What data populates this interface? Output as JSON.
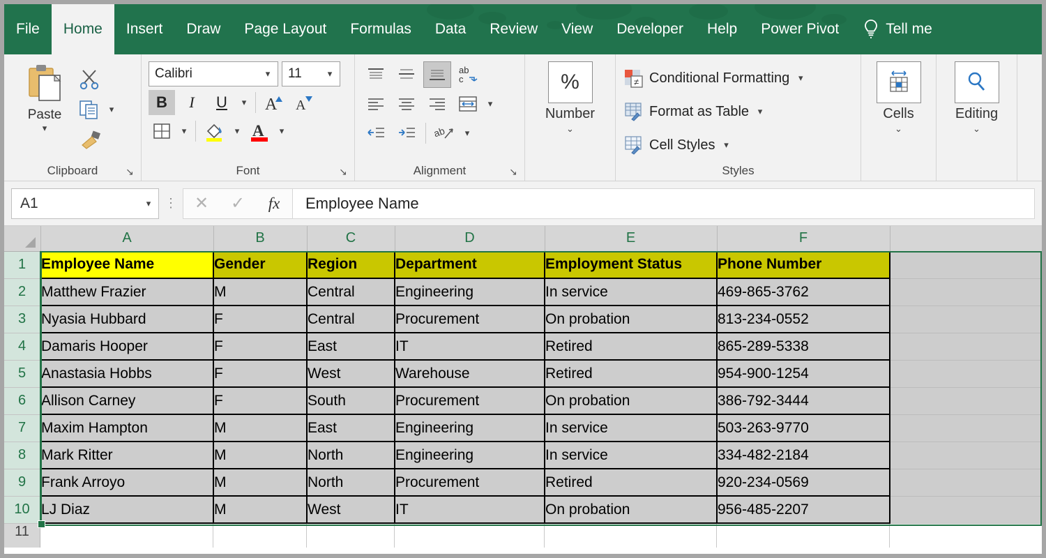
{
  "app": {
    "accent_green": "#21734d",
    "header_fill": "#ffff00",
    "header_fill_selected": "#c9c700",
    "selection_fill": "#cdcdcd",
    "selection_border": "#217346"
  },
  "ribbon_tabs": [
    {
      "label": "File",
      "active": false
    },
    {
      "label": "Home",
      "active": true
    },
    {
      "label": "Insert",
      "active": false
    },
    {
      "label": "Draw",
      "active": false
    },
    {
      "label": "Page Layout",
      "active": false
    },
    {
      "label": "Formulas",
      "active": false
    },
    {
      "label": "Data",
      "active": false
    },
    {
      "label": "Review",
      "active": false
    },
    {
      "label": "View",
      "active": false
    },
    {
      "label": "Developer",
      "active": false
    },
    {
      "label": "Help",
      "active": false
    },
    {
      "label": "Power Pivot",
      "active": false
    }
  ],
  "tell_me": {
    "label": "Tell me",
    "icon": "lightbulb-icon"
  },
  "ribbon": {
    "clipboard": {
      "group_label": "Clipboard",
      "paste_label": "Paste",
      "cut_icon": "scissors-icon",
      "copy_icon": "copy-icon",
      "format_painter_icon": "format-painter-icon",
      "dialog_launcher": "↘"
    },
    "font": {
      "group_label": "Font",
      "font_name": "Calibri",
      "font_size": "11",
      "bold_label": "B",
      "italic_label": "I",
      "underline_label": "U",
      "grow_font_label": "A",
      "shrink_font_label": "A",
      "borders_icon": "borders-icon",
      "fill_color_icon": "fill-color-icon",
      "font_color_icon": "font-color-icon",
      "dialog_launcher": "↘"
    },
    "alignment": {
      "group_label": "Alignment",
      "top_align_icon": "align-top-icon",
      "middle_align_icon": "align-middle-icon",
      "bottom_align_icon": "align-bottom-icon",
      "orientation_icon": "text-orientation-icon",
      "wrap_text_icon": "wrap-text-icon",
      "align_left_icon": "align-left-icon",
      "align_center_icon": "align-center-icon",
      "align_right_icon": "align-right-icon",
      "merge_center_icon": "merge-and-center-icon",
      "decrease_indent_icon": "decrease-indent-icon",
      "increase_indent_icon": "increase-indent-icon",
      "dialog_launcher": "↘"
    },
    "number": {
      "group_label": "Number",
      "button_label": "%",
      "dropdown_caret": "⌄"
    },
    "styles": {
      "group_label": "Styles",
      "items": [
        {
          "label": "Conditional Formatting",
          "icon": "conditional-formatting-icon"
        },
        {
          "label": "Format as Table",
          "icon": "format-as-table-icon"
        },
        {
          "label": "Cell Styles",
          "icon": "cell-styles-icon"
        }
      ]
    },
    "cells": {
      "group_label": "Cells",
      "icon": "cells-insert-icon",
      "dropdown_caret": "⌄"
    },
    "editing": {
      "group_label": "Editing",
      "icon": "find-select-icon",
      "dropdown_caret": "⌄"
    }
  },
  "formula_bar": {
    "name_box_value": "A1",
    "name_box_caret": "▾",
    "cancel_icon": "cancel-x-icon",
    "enter_icon": "confirm-check-icon",
    "function_icon": "fx-icon",
    "formula_value": "Employee Name"
  },
  "sheet": {
    "column_headers": [
      "A",
      "B",
      "C",
      "D",
      "E",
      "F"
    ],
    "row_numbers": [
      "1",
      "2",
      "3",
      "4",
      "5",
      "6",
      "7",
      "8",
      "9",
      "10"
    ],
    "partial_row_number": "11",
    "table_headers": [
      "Employee Name",
      "Gender",
      "Region",
      "Department",
      "Employment Status",
      "Phone Number"
    ],
    "rows": [
      [
        "Matthew Frazier",
        "M",
        "Central",
        "Engineering",
        "In service",
        "469-865-3762"
      ],
      [
        "Nyasia Hubbard",
        "F",
        "Central",
        "Procurement",
        "On probation",
        "813-234-0552"
      ],
      [
        "Damaris Hooper",
        "F",
        "East",
        "IT",
        "Retired",
        "865-289-5338"
      ],
      [
        "Anastasia Hobbs",
        "F",
        "West",
        "Warehouse",
        "Retired",
        "954-900-1254"
      ],
      [
        "Allison Carney",
        "F",
        "South",
        "Procurement",
        "On probation",
        "386-792-3444"
      ],
      [
        "Maxim Hampton",
        "M",
        "East",
        "Engineering",
        "In service",
        "503-263-9770"
      ],
      [
        "Mark Ritter",
        "M",
        "North",
        "Engineering",
        "In service",
        "334-482-2184"
      ],
      [
        "Frank Arroyo",
        "M",
        "North",
        "Procurement",
        "Retired",
        "920-234-0569"
      ],
      [
        "LJ Diaz",
        "M",
        "West",
        "IT",
        "On probation",
        "956-485-2207"
      ]
    ]
  }
}
